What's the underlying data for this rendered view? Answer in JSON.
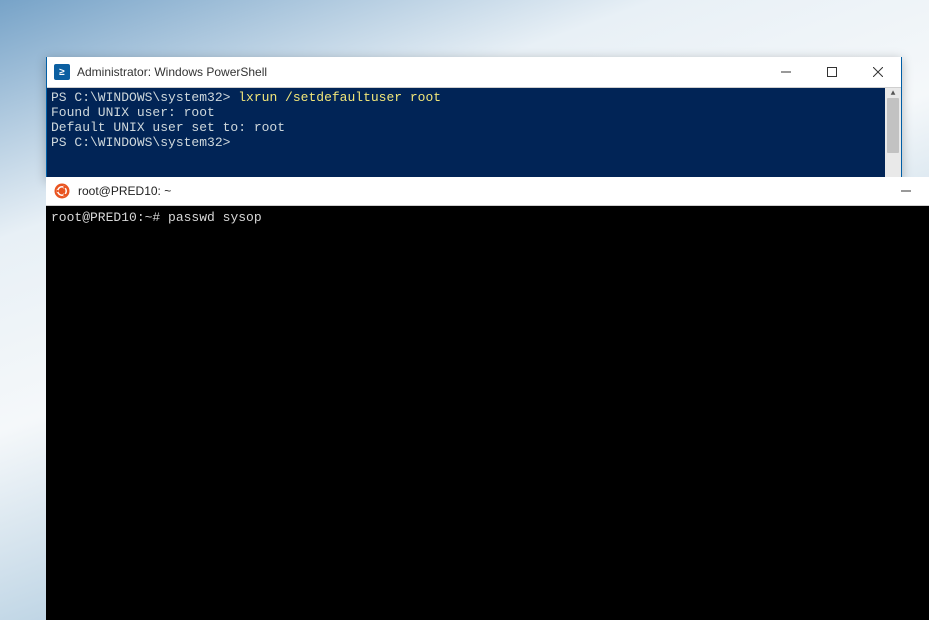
{
  "desktop": {},
  "powershell": {
    "title": "Administrator: Windows PowerShell",
    "prompt1_prefix": "PS C:\\WINDOWS\\system32>",
    "prompt1_command": "lxrun /setdefaultuser root",
    "line2": "Found UNIX user: root",
    "line3": "Default UNIX user set to: root",
    "prompt2_prefix": "PS C:\\WINDOWS\\system32>"
  },
  "bash": {
    "title": "root@PRED10: ~",
    "prompt_prefix": "root@PRED10:~#",
    "command": "passwd sysop"
  }
}
